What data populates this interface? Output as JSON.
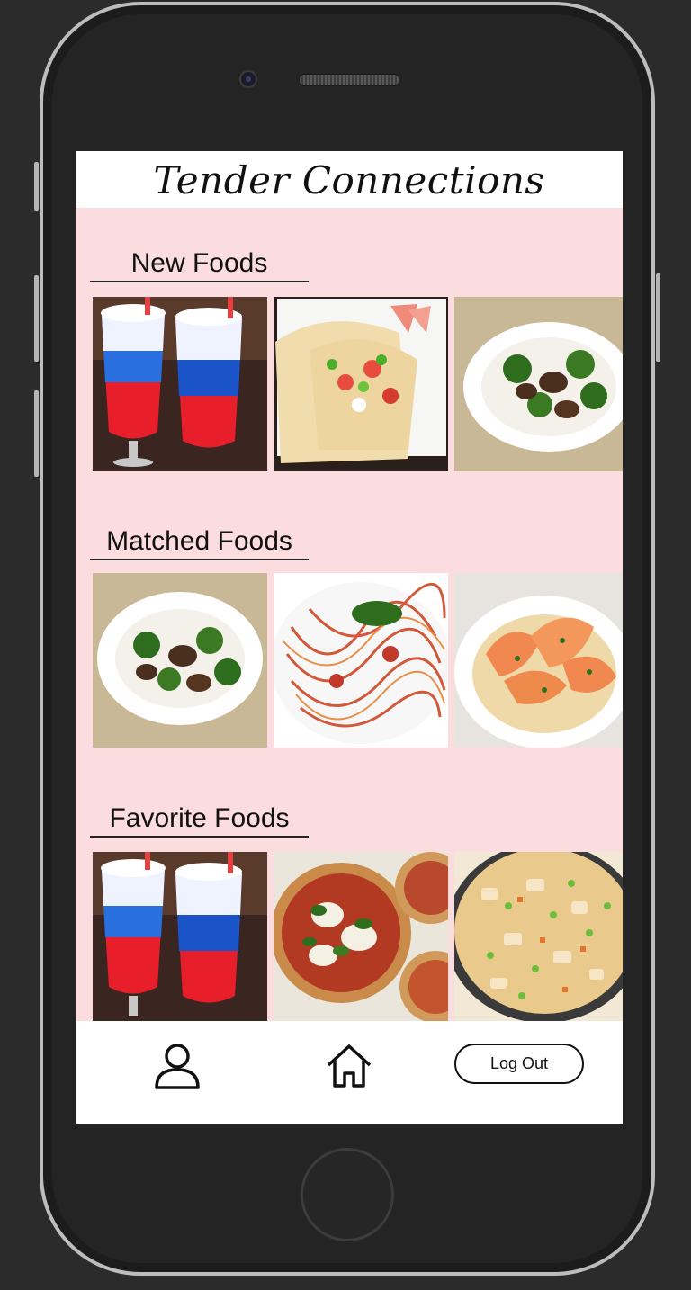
{
  "app": {
    "title": "Tender Connections"
  },
  "sections": [
    {
      "label": "New Foods",
      "items": [
        "layered-slush-drink",
        "fish-tacos",
        "beef-broccoli"
      ]
    },
    {
      "label": "Matched Foods",
      "items": [
        "beef-broccoli",
        "spaghetti-marinara",
        "garlic-shrimp"
      ]
    },
    {
      "label": "Favorite Foods",
      "items": [
        "layered-slush-drink",
        "basil-pizza",
        "chicken-fried-rice"
      ]
    }
  ],
  "nav": {
    "profile_icon": "user-icon",
    "home_icon": "home-icon",
    "logout_label": "Log Out"
  },
  "colors": {
    "screen_bg": "#fbdde0",
    "header_bg": "#ffffff"
  }
}
